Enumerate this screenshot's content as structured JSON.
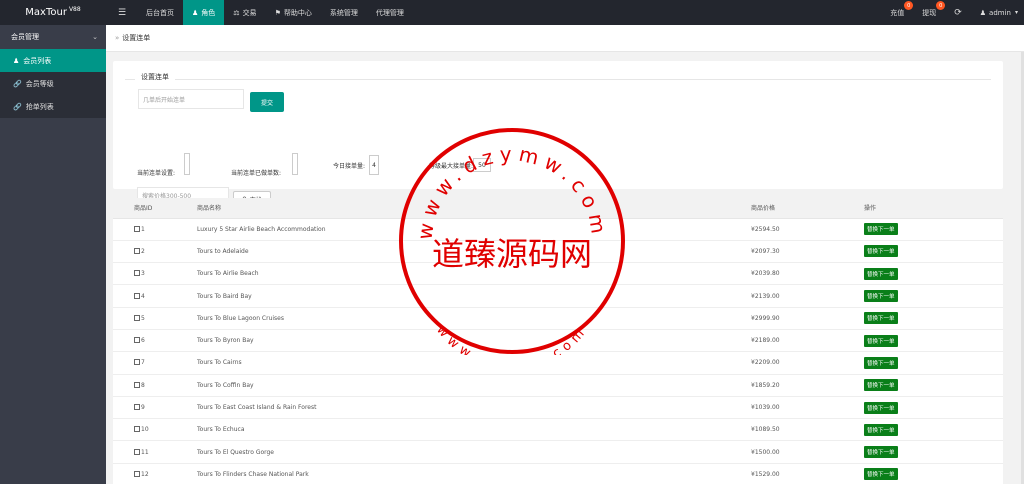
{
  "header": {
    "logo": "MaxTour",
    "logo_version": "V88",
    "nav": [
      {
        "label": "后台首页",
        "icon": ""
      },
      {
        "label": "角色",
        "icon": "user-icon"
      },
      {
        "label": "交易",
        "icon": "scale-icon"
      },
      {
        "label": "帮助中心",
        "icon": "flag-icon"
      },
      {
        "label": "系统管理",
        "icon": ""
      },
      {
        "label": "代理管理",
        "icon": ""
      }
    ],
    "recharge": {
      "label": "充值",
      "badge": "0"
    },
    "withdraw": {
      "label": "提现",
      "badge": "0"
    },
    "user": "admin"
  },
  "sidebar": {
    "group": "会员管理",
    "items": [
      {
        "label": "会员列表",
        "icon": "user-icon"
      },
      {
        "label": "会员等级",
        "icon": "link-icon"
      },
      {
        "label": "抢单列表",
        "icon": "link-icon"
      }
    ]
  },
  "breadcrumb": "设置连单",
  "form": {
    "legend": "设置连单",
    "start_placeholder": "几单后开始连单",
    "submit": "提交",
    "current_setting_label": "当前连单设置:",
    "done_count_label": "当前连单已做单数:",
    "today_count_label": "今日接单量:",
    "today_count_value": "4",
    "level_max_label": "等级最大接单量:",
    "level_max_value": "50",
    "price_placeholder": "搜索价格300-500",
    "search": "查找"
  },
  "table": {
    "headers": [
      "商品ID",
      "商品名称",
      "商品价格",
      "操作"
    ],
    "action_label": "替换下一单",
    "rows": [
      {
        "id": "1",
        "name": "Luxury 5 Star Airlie Beach Accommodation",
        "price": "¥2594.50"
      },
      {
        "id": "2",
        "name": "Tours to Adelaide",
        "price": "¥2097.30"
      },
      {
        "id": "3",
        "name": "Tours To Airlie Beach",
        "price": "¥2039.80"
      },
      {
        "id": "4",
        "name": "Tours To Baird Bay",
        "price": "¥2139.00"
      },
      {
        "id": "5",
        "name": "Tours To Blue Lagoon Cruises",
        "price": "¥2999.90"
      },
      {
        "id": "6",
        "name": "Tours To Byron Bay",
        "price": "¥2189.00"
      },
      {
        "id": "7",
        "name": "Tours To Cairns",
        "price": "¥2209.00"
      },
      {
        "id": "8",
        "name": "Tours To Coffin Bay",
        "price": "¥1859.20"
      },
      {
        "id": "9",
        "name": "Tours To East Coast Island & Rain Forest",
        "price": "¥1039.00"
      },
      {
        "id": "10",
        "name": "Tours To Echuca",
        "price": "¥1089.50"
      },
      {
        "id": "11",
        "name": "Tours To El Questro Gorge",
        "price": "¥1500.00"
      },
      {
        "id": "12",
        "name": "Tours To Flinders Chase National Park",
        "price": "¥1529.00"
      }
    ]
  },
  "watermark": {
    "center": "道臻源码网",
    "ring_top": "www.dzymw.com",
    "ring_bottom": "www.dzymw.com",
    "color": "#e00000"
  }
}
